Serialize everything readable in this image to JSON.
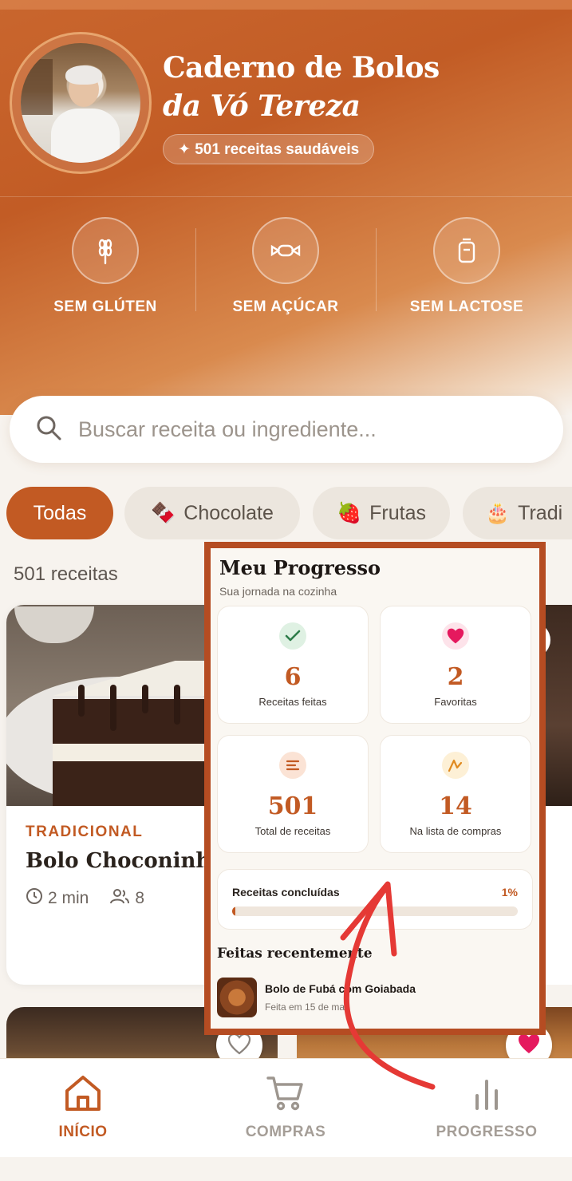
{
  "header": {
    "title_line1": "Caderno de Bolos",
    "title_line2": "da Vó Tereza",
    "badge": "✦ 501 receitas saudáveis"
  },
  "diets": [
    {
      "label": "SEM GLÚTEN",
      "icon": "wheat-icon"
    },
    {
      "label": "SEM AÇÚCAR",
      "icon": "candy-icon"
    },
    {
      "label": "SEM LACTOSE",
      "icon": "milk-bottle-icon"
    }
  ],
  "search": {
    "placeholder": "Buscar receita ou ingrediente..."
  },
  "filters": [
    {
      "label": "Todas",
      "emoji": "",
      "active": true
    },
    {
      "label": "Chocolate",
      "emoji": "🍫",
      "active": false
    },
    {
      "label": "Frutas",
      "emoji": "🍓",
      "active": false
    },
    {
      "label": "Tradi",
      "emoji": "🎂",
      "active": false
    }
  ],
  "recipes_count": "501 receitas",
  "recipe_card": {
    "category": "TRADICIONAL",
    "title": "Bolo Choconinho",
    "time": "2 min",
    "servings": "8"
  },
  "progress": {
    "title": "Meu Progresso",
    "subtitle": "Sua jornada na cozinha",
    "stats": [
      {
        "value": "6",
        "label": "Receitas feitas",
        "icon": "check-icon"
      },
      {
        "value": "2",
        "label": "Favoritas",
        "icon": "heart-icon"
      },
      {
        "value": "501",
        "label": "Total de receitas",
        "icon": "list-icon"
      },
      {
        "value": "14",
        "label": "Na lista de compras",
        "icon": "chart-icon"
      }
    ],
    "completed_label": "Receitas concluídas",
    "completed_pct": "1%",
    "completed_fraction": 0.01,
    "recent_title": "Feitas recentemente",
    "recent": [
      {
        "name": "Bolo de Fubá com Goiabada",
        "date": "Feita em 15 de mar."
      }
    ]
  },
  "nav": {
    "items": [
      {
        "label": "INÍCIO",
        "active": true
      },
      {
        "label": "COMPRAS",
        "active": false
      },
      {
        "label": "PROGRESSO",
        "active": false
      }
    ]
  },
  "colors": {
    "accent": "#c25a23",
    "annotation": "#e53935"
  }
}
